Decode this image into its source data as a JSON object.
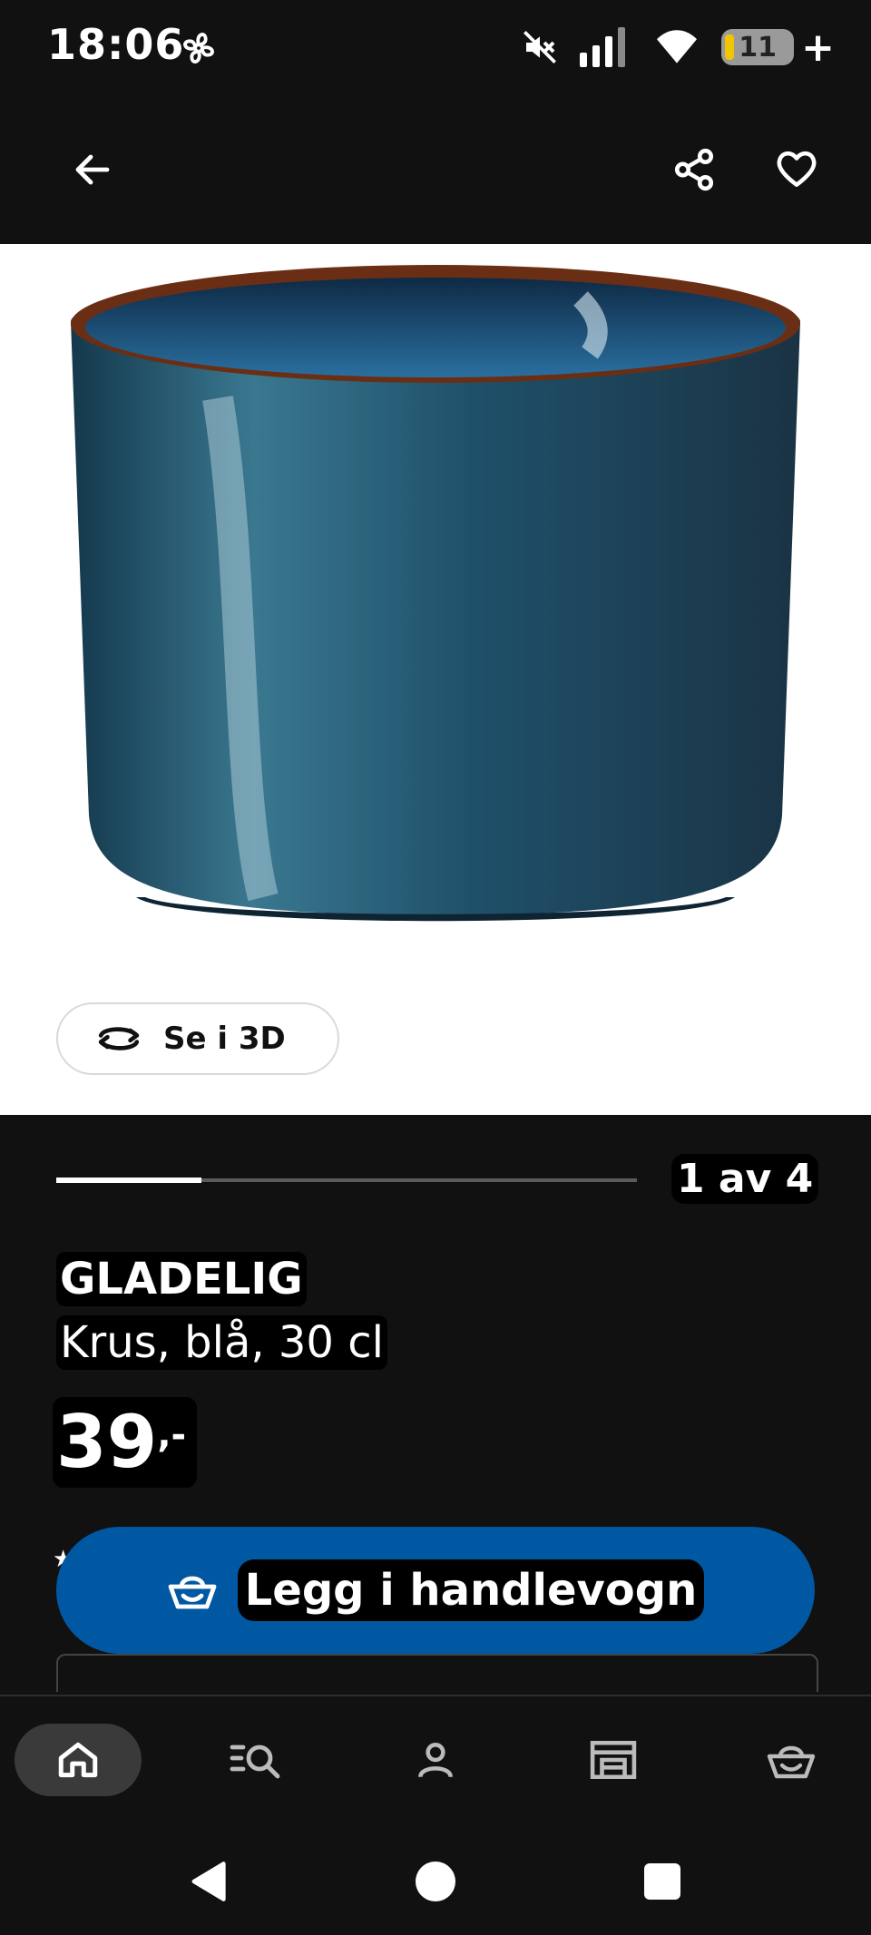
{
  "status_bar": {
    "time": "18:06",
    "battery_level": "11",
    "icons": [
      "fan-icon",
      "mute-icon",
      "signal-icon",
      "wifi-icon",
      "battery-icon",
      "charging-plus-icon"
    ]
  },
  "top_bar": {
    "icons": [
      "back-arrow-icon",
      "share-icon",
      "heart-icon"
    ]
  },
  "gallery": {
    "view_3d_label": "Se i 3D",
    "counter": "1 av 4",
    "progress_fraction": 0.25
  },
  "product": {
    "name": "GLADELIG",
    "description": "Krus, blå, 30 cl",
    "price": "39",
    "price_suffix": ",-"
  },
  "actions": {
    "add_to_cart_label": "Legg i handlevogn"
  },
  "bottom_nav": {
    "items": [
      {
        "icon": "home-icon",
        "active": true
      },
      {
        "icon": "search-list-icon",
        "active": false
      },
      {
        "icon": "profile-icon",
        "active": false
      },
      {
        "icon": "store-icon",
        "active": false
      },
      {
        "icon": "cart-icon",
        "active": false
      }
    ]
  },
  "system_nav": {
    "icons": [
      "back-triangle-icon",
      "home-circle-icon",
      "recents-square-icon"
    ]
  },
  "colors": {
    "background": "#111111",
    "accent_blue": "#0058a3",
    "mug_blue": "#1f4f66",
    "mug_rim": "#7a3b1e"
  }
}
